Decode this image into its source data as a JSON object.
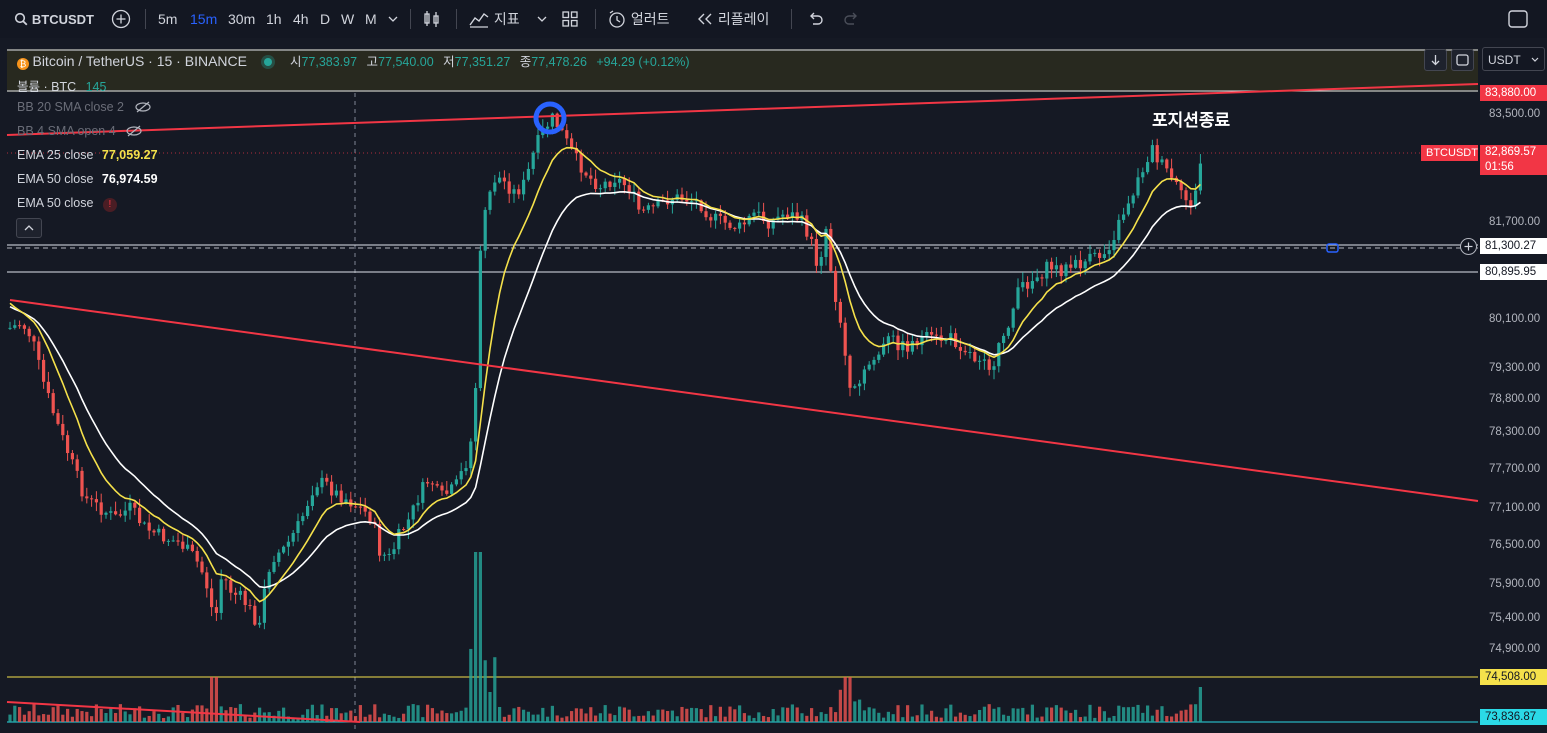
{
  "toolbar": {
    "symbol": "BTCUSDT",
    "intervals": [
      "5m",
      "15m",
      "30m",
      "1h",
      "4h",
      "D",
      "W",
      "M"
    ],
    "active_interval": "15m",
    "indicators_label": "지표",
    "alerts_label": "얼러트",
    "replay_label": "리플레이"
  },
  "legend": {
    "title": "Bitcoin / TetherUS · 15 · BINANCE",
    "open_prefix": "시",
    "open": "77,383.97",
    "high_prefix": "고",
    "high": "77,540.00",
    "low_prefix": "저",
    "low": "77,351.27",
    "close_prefix": "종",
    "close": "77,478.26",
    "change": "+94.29 (+0.12%)",
    "volume_label": "볼륨 · BTC",
    "volume_value": "145",
    "indicators": [
      {
        "label": "BB 20 SMA close 2",
        "value": ""
      },
      {
        "label": "BB 4 SMA open 4",
        "value": ""
      },
      {
        "label": "EMA 25 close",
        "value": "77,059.27"
      },
      {
        "label": "EMA 50 close",
        "value": "76,974.59"
      },
      {
        "label": "EMA 50 close",
        "value": ""
      }
    ]
  },
  "currency": "USDT",
  "annotation": "포지션종료",
  "price_axis": {
    "ticks": [
      "83,500.00",
      "81,700.00",
      "80,100.00",
      "79,300.00",
      "78,800.00",
      "78,300.00",
      "77,700.00",
      "77,100.00",
      "76,500.00",
      "75,900.00",
      "75,400.00",
      "74,900.00"
    ],
    "level_labels": {
      "top_line": "83,880.00",
      "last_symbol": "BTCUSDT",
      "last_price": "82,869.57",
      "countdown": "01:56",
      "crosshair": "81,300.27",
      "white_line": "80,895.95",
      "yellow_line": "74,508.00",
      "bottom": "73,836.87"
    }
  },
  "colors": {
    "up": "#26a69a",
    "down": "#ef5350",
    "ema25": "#f5e14b",
    "ema50": "#ffffff",
    "trendline": "#f23645",
    "background": "#151924"
  }
}
